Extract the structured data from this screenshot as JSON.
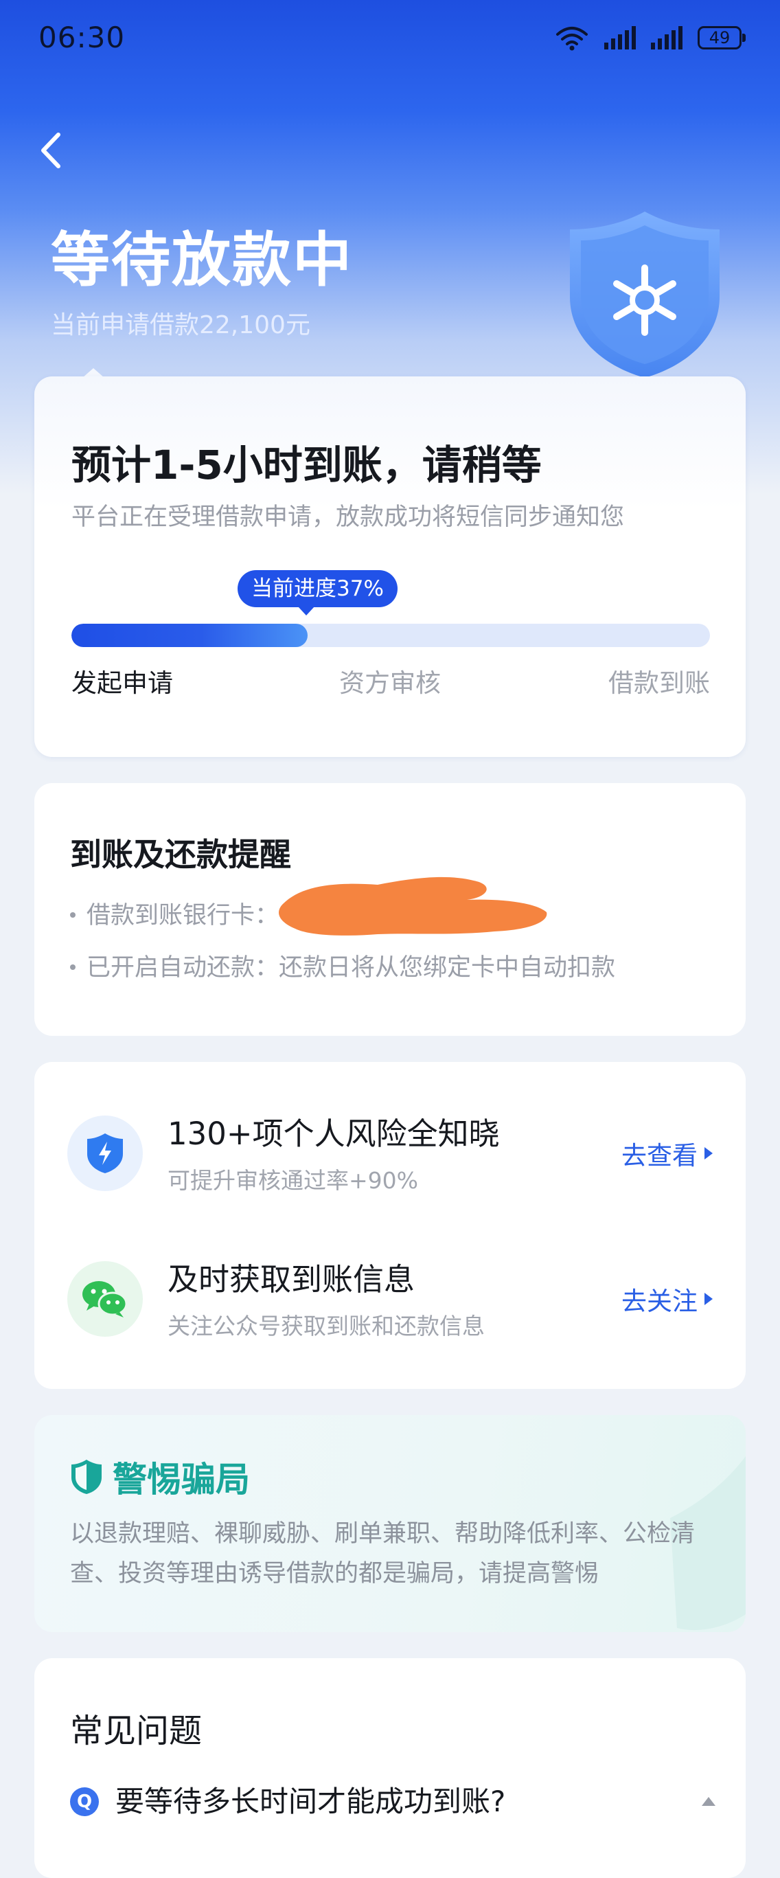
{
  "status_bar": {
    "time": "06:30",
    "battery": "49",
    "icons": [
      "wifi-icon",
      "signal-icon",
      "signal-icon",
      "battery-icon"
    ]
  },
  "header": {
    "back_icon": "chevron-left-icon",
    "title": "等待放款中",
    "subtitle": "当前申请借款22,100元",
    "badge_icon": "shield-snowflake-icon"
  },
  "progress_card": {
    "title": "预计1-5小时到账，请稍等",
    "description": "平台正在受理借款申请，放款成功将短信同步通知您",
    "progress_label": "当前进度37%",
    "progress_value": 0.37,
    "steps": [
      {
        "label": "发起申请",
        "active": true
      },
      {
        "label": "资方审核",
        "active": false
      },
      {
        "label": "借款到账",
        "active": false
      }
    ]
  },
  "remind_card": {
    "title": "到账及还款提醒",
    "lines": [
      "借款到账银行卡：",
      "已开启自动还款：还款日将从您绑定卡中自动扣款"
    ]
  },
  "services": [
    {
      "icon": "lightning-shield-icon",
      "title": "130+项个人风险全知晓",
      "subtitle": "可提升审核通过率+90%",
      "action": "去查看"
    },
    {
      "icon": "wechat-icon",
      "title": "及时获取到账信息",
      "subtitle": "关注公众号获取到账和还款信息",
      "action": "去关注"
    }
  ],
  "warning_card": {
    "icon": "shield-check-icon",
    "title": "警惕骗局",
    "body": "以退款理赔、裸聊威胁、刷单兼职、帮助降低利率、公检清查、投资等理由诱导借款的都是骗局，请提高警惕"
  },
  "faq_card": {
    "title": "常见问题",
    "items": [
      {
        "badge": "Q",
        "question": "要等待多长时间才能成功到账?"
      }
    ]
  },
  "colors": {
    "brand_blue": "#2152e8",
    "action_blue": "#2a5fe5",
    "warning_teal": "#19a69a",
    "redaction_orange": "#f47a30"
  }
}
